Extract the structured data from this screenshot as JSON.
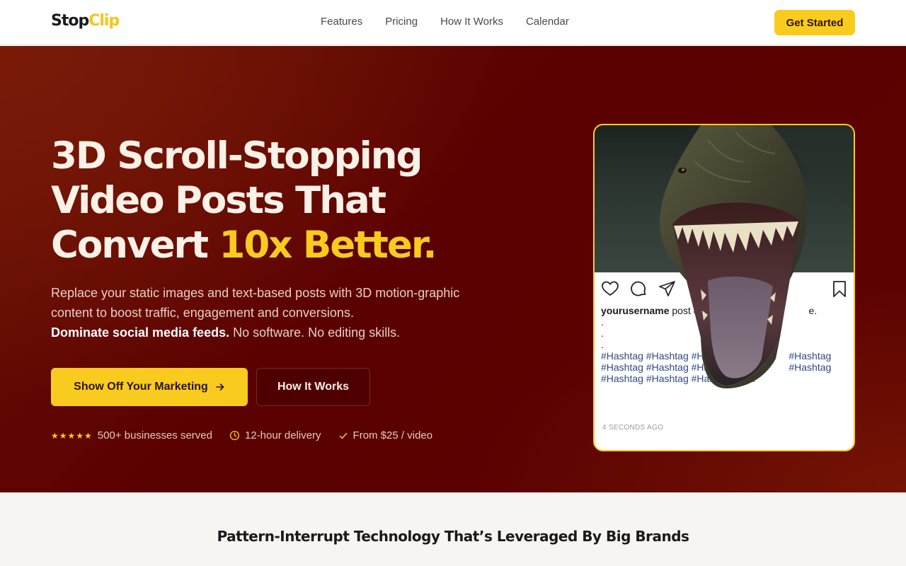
{
  "nav": {
    "logo_part1": "Stop",
    "logo_part2": "Clip",
    "links": [
      "Features",
      "Pricing",
      "How It Works",
      "Calendar"
    ],
    "cta": "Get Started"
  },
  "hero": {
    "headline_line1": "3D Scroll-Stopping",
    "headline_line2": "Video Posts That",
    "headline_line3a": "Convert ",
    "headline_line3b": "10x Better.",
    "subtext_a": "Replace your static images and text-based posts with 3D motion-graphic content to boost traffic, engagement and conversions.",
    "subtext_bold": "Dominate social media feeds.",
    "subtext_b": " No software. No editing skills.",
    "primary_button": "Show Off Your Marketing",
    "secondary_button": "How It Works",
    "trust": {
      "stars": "★★★★★",
      "served": "500+ businesses served",
      "delivery": "12-hour delivery",
      "price": "From $25 / video"
    }
  },
  "post": {
    "username": "yourusername",
    "caption": " post co",
    "caption_tail": "e.",
    "dots": [
      ".",
      ".",
      "."
    ],
    "hashtag_rows": [
      "#Hashtag #Hashtag #Hashtag                    #Hashtag",
      "#Hashtag #Hashtag #Hashtag                    #Hashtag",
      "#Hashtag #Hashtag #Hashtag #Ha"
    ],
    "timestamp": "4 SECONDS AGO"
  },
  "section2": {
    "title": "Pattern-Interrupt Technology That’s Leveraged By Big Brands"
  },
  "colors": {
    "accent": "#f9cb1f",
    "hero_bg": "#5a0000"
  }
}
